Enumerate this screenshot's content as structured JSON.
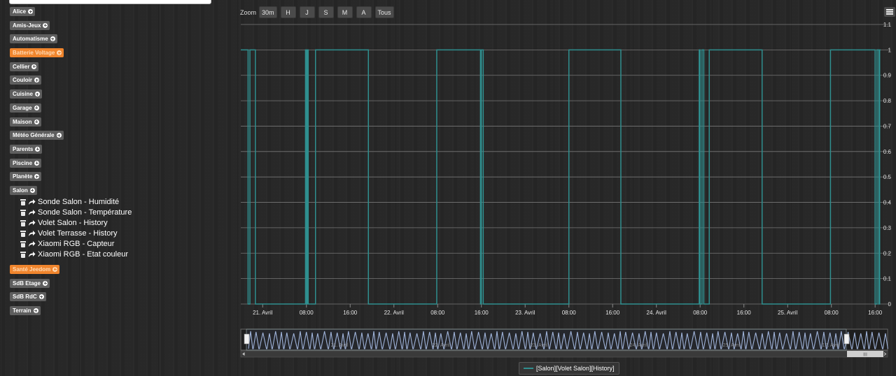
{
  "sidebar": {
    "groups": [
      {
        "name": "Alice",
        "active": false,
        "commands": []
      },
      {
        "name": "Amis-Jeux",
        "active": false,
        "commands": []
      },
      {
        "name": "Automatisme",
        "active": false,
        "commands": []
      },
      {
        "name": "Batterie Voltage",
        "active": true,
        "commands": []
      },
      {
        "name": "Cellier",
        "active": false,
        "commands": []
      },
      {
        "name": "Couloir",
        "active": false,
        "commands": []
      },
      {
        "name": "Cuisine",
        "active": false,
        "commands": []
      },
      {
        "name": "Garage",
        "active": false,
        "commands": []
      },
      {
        "name": "Maison",
        "active": false,
        "commands": []
      },
      {
        "name": "Météo Générale",
        "active": false,
        "commands": []
      },
      {
        "name": "Parents",
        "active": false,
        "commands": []
      },
      {
        "name": "Piscine",
        "active": false,
        "commands": []
      },
      {
        "name": "Planète",
        "active": false,
        "commands": []
      },
      {
        "name": "Salon",
        "active": false,
        "commands": [
          "Sonde Salon - Humidité",
          "Sonde Salon - Température",
          "Volet Salon - History",
          "Volet Terrasse - History",
          "Xiaomi RGB - Capteur",
          "Xiaomi RGB - Etat couleur"
        ]
      },
      {
        "name": "Santé Jeedom",
        "active": true,
        "commands": []
      },
      {
        "name": "SdB Etage",
        "active": false,
        "commands": []
      },
      {
        "name": "SdB RdC",
        "active": false,
        "commands": []
      },
      {
        "name": "Terrain",
        "active": false,
        "commands": []
      }
    ]
  },
  "toolbar": {
    "zoom_label": "Zoom",
    "zoom_buttons": [
      "30m",
      "H",
      "J",
      "S",
      "M",
      "A",
      "Tous"
    ],
    "menu_icon": "hamburger-icon"
  },
  "navigator": {
    "labels": [
      "21. Avril",
      "22. Avril",
      "23. Avril",
      "24. Avril",
      "25. Avril",
      "17. Avril"
    ],
    "scrollbar_grip": "III"
  },
  "colors": {
    "series": "#2f8f8f",
    "navigator_series": "#9fb3d9",
    "active_group": "#f0852d",
    "gridline": "#777777"
  },
  "chart_data": {
    "type": "line",
    "step": true,
    "series": [
      {
        "name": "[Salon][Volet Salon][History]",
        "points": [
          [
            "2018-04-20 20:00",
            1
          ],
          [
            "2018-04-20 21:20",
            0
          ],
          [
            "2018-04-20 21:40",
            1
          ],
          [
            "2018-04-20 22:40",
            0
          ],
          [
            "2018-04-21 07:50",
            1
          ],
          [
            "2018-04-21 08:00",
            0
          ],
          [
            "2018-04-21 08:10",
            1
          ],
          [
            "2018-04-21 08:20",
            0
          ],
          [
            "2018-04-21 09:40",
            1
          ],
          [
            "2018-04-21 19:20",
            0
          ],
          [
            "2018-04-22 07:50",
            1
          ],
          [
            "2018-04-22 15:50",
            0
          ],
          [
            "2018-04-22 16:00",
            1
          ],
          [
            "2018-04-22 16:20",
            0
          ],
          [
            "2018-04-23 08:00",
            1
          ],
          [
            "2018-04-23 17:30",
            0
          ],
          [
            "2018-04-24 07:50",
            1
          ],
          [
            "2018-04-24 08:00",
            0
          ],
          [
            "2018-04-24 08:20",
            1
          ],
          [
            "2018-04-24 08:40",
            0
          ],
          [
            "2018-04-24 09:40",
            1
          ],
          [
            "2018-04-24 19:20",
            0
          ],
          [
            "2018-04-25 07:50",
            1
          ],
          [
            "2018-04-25 16:00",
            0
          ],
          [
            "2018-04-25 16:20",
            1
          ],
          [
            "2018-04-25 16:40",
            0
          ],
          [
            "2018-04-25 16:50",
            1
          ]
        ]
      }
    ],
    "x_ticks": [
      "21. Avril",
      "08:00",
      "16:00",
      "22. Avril",
      "08:00",
      "16:00",
      "23. Avril",
      "08:00",
      "16:00",
      "24. Avril",
      "08:00",
      "16:00",
      "25. Avril",
      "08:00",
      "16:00"
    ],
    "y_ticks": [
      "0",
      "0.1",
      "0.2",
      "0.3",
      "0.4",
      "0.5",
      "0.6",
      "0.7",
      "0.8",
      "0.9",
      "1",
      "1.1"
    ],
    "xlim": [
      "2018-04-20 20:00",
      "2018-04-25 17:00"
    ],
    "ylim": [
      0,
      1.1
    ],
    "grid": true,
    "legend": "bottom-center",
    "title": "",
    "xlabel": "",
    "ylabel": ""
  }
}
